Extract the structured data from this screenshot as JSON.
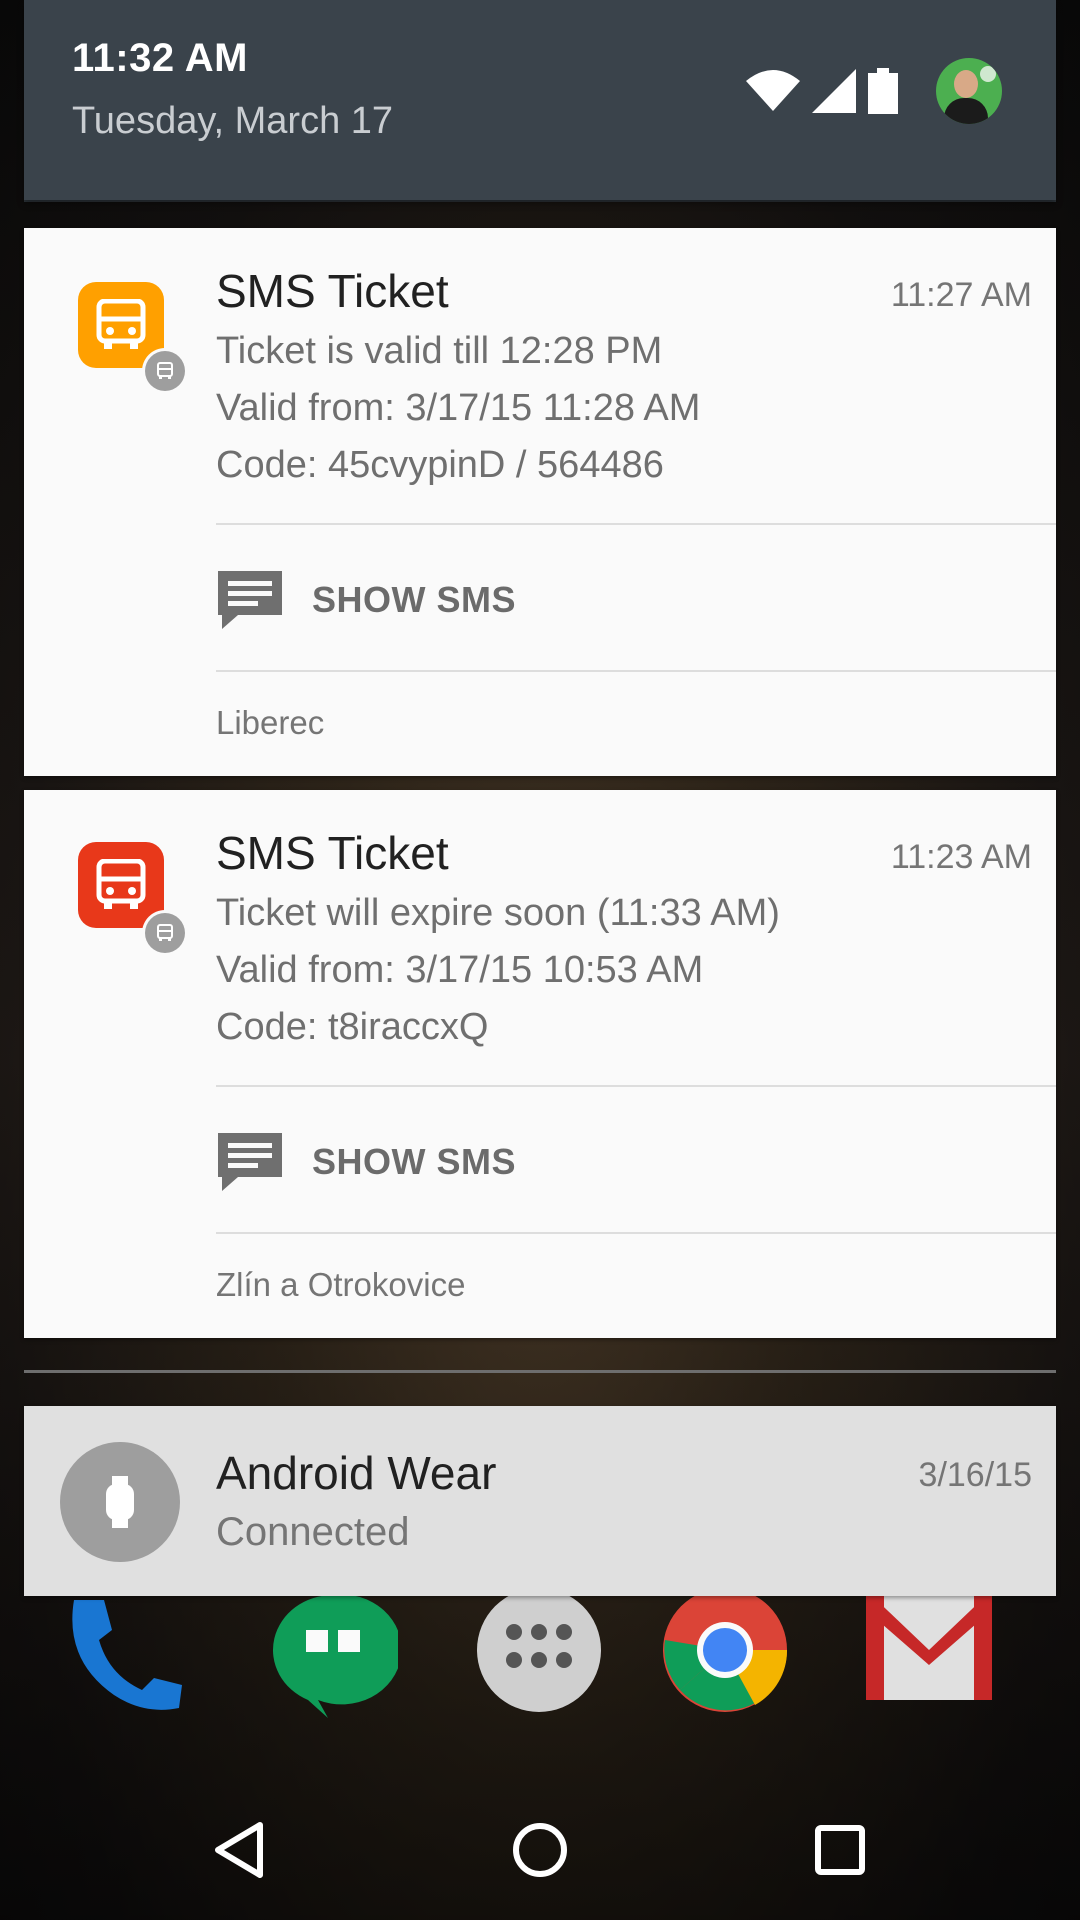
{
  "header": {
    "time": "11:32 AM",
    "date": "Tuesday, March 17"
  },
  "notifications": [
    {
      "title": "SMS Ticket",
      "time": "11:27 AM",
      "lines": [
        "Ticket is valid till 12:28 PM",
        "Valid from: 3/17/15 11:28 AM",
        "Code: 45cvypinD / 564486"
      ],
      "action": "SHOW SMS",
      "subtext": "Liberec",
      "color": "#ffa000"
    },
    {
      "title": "SMS Ticket",
      "time": "11:23 AM",
      "lines": [
        "Ticket will expire soon (11:33 AM)",
        "Valid from: 3/17/15 10:53 AM",
        "Code: t8iraccxQ"
      ],
      "action": "SHOW SMS",
      "subtext": "Zlín a Otrokovice",
      "color": "#e8381a"
    }
  ],
  "wear": {
    "title": "Android Wear",
    "status": "Connected",
    "date": "3/16/15"
  },
  "icons": {
    "wifi": "wifi-icon",
    "signal": "signal-icon",
    "battery": "battery-icon",
    "bus": "bus-icon",
    "message": "message-icon",
    "watch": "watch-icon",
    "back": "back-icon",
    "home": "home-icon",
    "recents": "recents-icon"
  }
}
